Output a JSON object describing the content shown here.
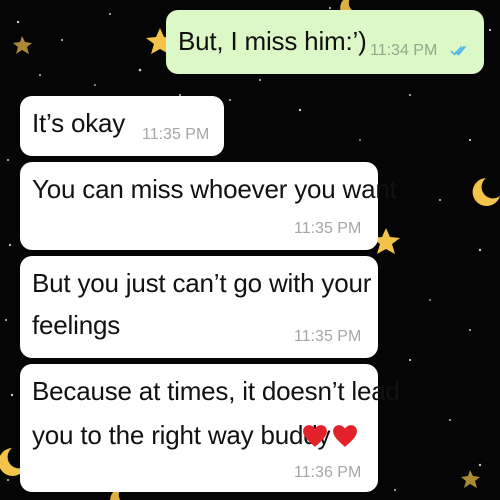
{
  "conversation": {
    "messages": [
      {
        "direction": "outgoing",
        "lines": [
          "But, I miss him:’)"
        ],
        "time": "11:34 PM",
        "status_icon": "double-check-read-icon"
      },
      {
        "direction": "incoming",
        "lines": [
          "It’s okay"
        ],
        "time": "11:35 PM"
      },
      {
        "direction": "incoming",
        "lines": [
          "You can miss whoever you want"
        ],
        "time": "11:35 PM"
      },
      {
        "direction": "incoming",
        "lines": [
          "But you just can’t go with your",
          "feelings"
        ],
        "time": "11:35 PM"
      },
      {
        "direction": "incoming",
        "lines": [
          "Because at times, it doesn’t lead",
          "you to the right way buddy"
        ],
        "emoji": [
          "red-heart-icon",
          "red-heart-icon"
        ],
        "time": "11:36 PM"
      }
    ]
  },
  "wallpaper": {
    "description_icons": [
      "crescent-moon-icon",
      "star-icon"
    ]
  },
  "colors": {
    "outgoing_bubble": "#dcf8c6",
    "incoming_bubble": "#ffffff",
    "read_ticks": "#4fb6ec",
    "moon": "#f4c34a"
  }
}
